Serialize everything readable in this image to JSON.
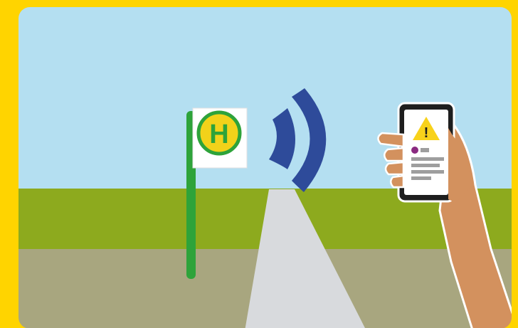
{
  "scene": {
    "colors": {
      "frame": "#FFD400",
      "sky": "#B4DFF1",
      "field": "#8DAA1E",
      "ground": "#A8A67F",
      "path": "#D8DADD",
      "pole": "#2EA33A",
      "sign_ring": "#2EA33A",
      "sign_fill": "#F2D21A",
      "signal_waves": "#2E4B9A",
      "phone_body": "#1E1E1E",
      "warning": "#F8D21B",
      "skin": "#D3915E",
      "dot": "#8A2A80"
    },
    "bus_stop_sign": {
      "letter": "H",
      "icon": "bus-stop-h-sign"
    },
    "signal": {
      "icon": "wireless-signal-waves"
    },
    "phone": {
      "alert_icon": "warning-triangle-icon",
      "alert_symbol": "!"
    }
  }
}
